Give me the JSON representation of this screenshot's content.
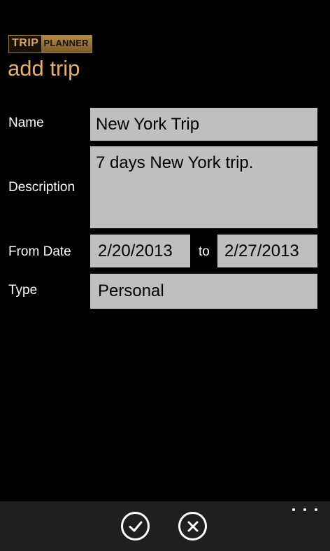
{
  "header": {
    "logo_trip": "TRIP",
    "logo_planner": "PLANNER",
    "title": "add trip"
  },
  "form": {
    "name_label": "Name",
    "name_value": "New York Trip",
    "description_label": "Description",
    "description_value": "7 days New York trip.",
    "from_date_label": "From Date",
    "from_date_value": "2/20/2013",
    "to_label": "to",
    "to_date_value": "2/27/2013",
    "type_label": "Type",
    "type_value": "Personal"
  },
  "app_bar": {
    "buttons": [
      {
        "icon": "check-icon"
      },
      {
        "icon": "close-icon"
      }
    ],
    "more_icon": "more-icon"
  },
  "colors": {
    "accent": "#e6ae66",
    "field_background": "#bfbfbf",
    "app_bar_background": "#1f1f1f"
  }
}
